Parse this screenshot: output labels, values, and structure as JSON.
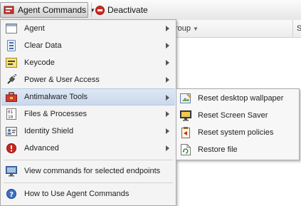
{
  "toolbar": {
    "agent_commands_label": "Agent Commands",
    "deactivate_label": "Deactivate"
  },
  "grid": {
    "group_col_label": "roup",
    "s_col_label": "S"
  },
  "menu": {
    "items": [
      {
        "label": "Agent",
        "icon": "agent-window-icon",
        "submenu": true
      },
      {
        "label": "Clear Data",
        "icon": "clear-data-icon",
        "submenu": true
      },
      {
        "label": "Keycode",
        "icon": "keycode-icon",
        "submenu": true
      },
      {
        "label": "Power & User Access",
        "icon": "power-plug-icon",
        "submenu": true
      },
      {
        "label": "Antimalware Tools",
        "icon": "toolbox-icon",
        "submenu": true,
        "highlighted": true
      },
      {
        "label": "Files & Processes",
        "icon": "files-processes-icon",
        "submenu": true
      },
      {
        "label": "Identity Shield",
        "icon": "identity-card-icon",
        "submenu": true
      },
      {
        "label": "Advanced",
        "icon": "warning-icon",
        "submenu": true
      },
      {
        "label": "View commands for selected endpoints",
        "icon": "monitor-icon",
        "submenu": false
      },
      {
        "label": "How to Use Agent Commands",
        "icon": "help-icon",
        "submenu": false
      }
    ]
  },
  "submenu": {
    "items": [
      {
        "label": "Reset desktop wallpaper",
        "icon": "wallpaper-icon"
      },
      {
        "label": "Reset Screen Saver",
        "icon": "screen-saver-icon"
      },
      {
        "label": "Reset system policies",
        "icon": "policies-icon"
      },
      {
        "label": "Restore file",
        "icon": "restore-file-icon"
      }
    ]
  },
  "colors": {
    "highlight": "#cddbee",
    "stop_red": "#d4281f",
    "menu_bg": "#f4f4f4"
  }
}
